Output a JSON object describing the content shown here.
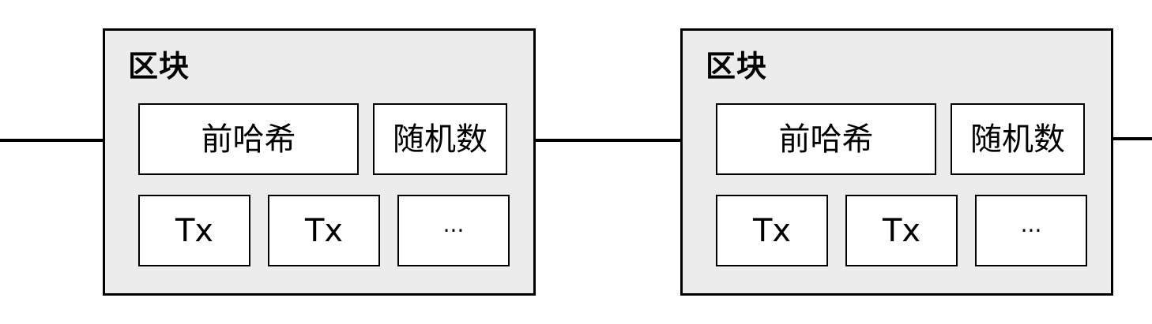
{
  "blocks": [
    {
      "title": "区块",
      "prev_hash": "前哈希",
      "nonce": "随机数",
      "transactions": [
        "Tx",
        "Tx",
        "···"
      ]
    },
    {
      "title": "区块",
      "prev_hash": "前哈希",
      "nonce": "随机数",
      "transactions": [
        "Tx",
        "Tx",
        "···"
      ]
    }
  ],
  "colors": {
    "block_fill": "#ececec",
    "cell_fill": "#ffffff",
    "stroke": "#000000"
  }
}
